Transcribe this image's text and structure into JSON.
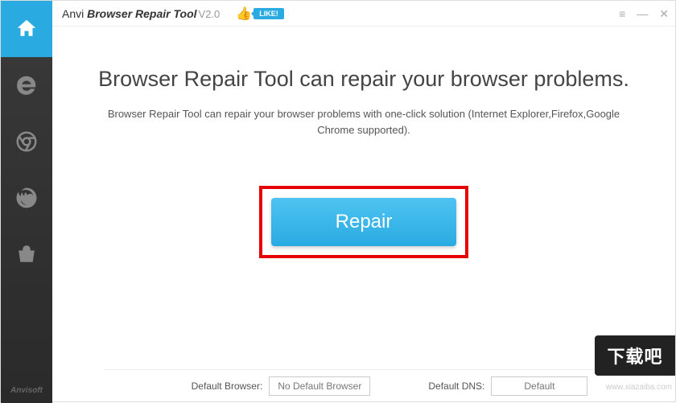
{
  "app": {
    "title_prefix": "Anvi ",
    "title_main": "Browser Repair Tool",
    "version": "V2.0",
    "like_label": "LIKE!"
  },
  "sidebar": {
    "footer_brand": "Anvisoft",
    "items": [
      {
        "name": "home"
      },
      {
        "name": "ie"
      },
      {
        "name": "chrome"
      },
      {
        "name": "firefox"
      },
      {
        "name": "store"
      }
    ]
  },
  "headline": "Browser Repair Tool can repair your browser problems.",
  "subtext": "Browser Repair Tool can repair your browser problems with one-click solution (Internet Explorer,Firefox,Google Chrome supported).",
  "repair_button": "Repair",
  "bottom": {
    "default_browser_label": "Default Browser:",
    "default_browser_value": "No Default Browser",
    "default_dns_label": "Default DNS:",
    "default_dns_value": "Default"
  },
  "watermark_url": "www.xiazaiba.com",
  "overlay_badge": "下载吧"
}
